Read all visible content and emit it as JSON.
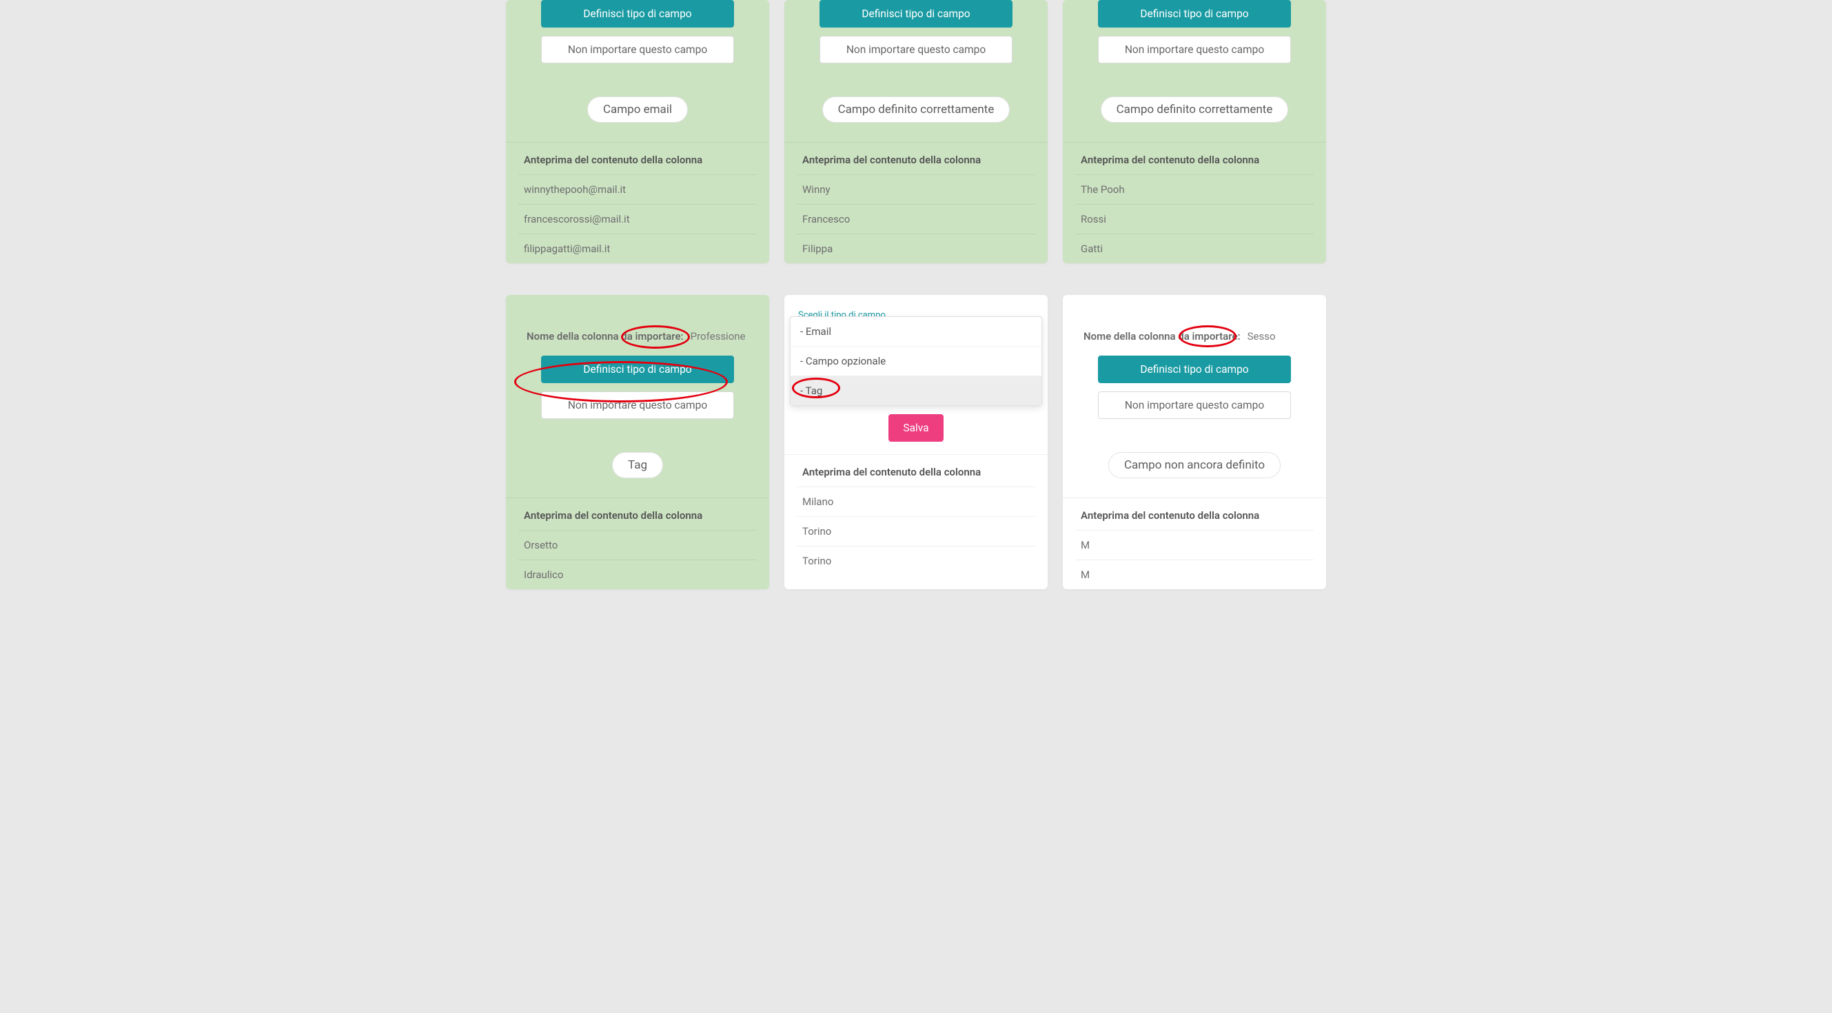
{
  "labels": {
    "define_field": "Definisci tipo di campo",
    "dont_import": "Non importare questo campo",
    "preview_header": "Anteprima del contenuto della colonna",
    "column_to_import": "Nome della colonna da importare:",
    "save": "Salva",
    "choose_field_type": "Scegli il tipo di campo"
  },
  "row1": [
    {
      "badge": "Campo email",
      "preview": [
        "winnythepooh@mail.it",
        "francescorossi@mail.it",
        "filippagatti@mail.it"
      ]
    },
    {
      "badge": "Campo definito correttamente",
      "preview": [
        "Winny",
        "Francesco",
        "Filippa"
      ]
    },
    {
      "badge": "Campo definito correttamente",
      "preview": [
        "The Pooh",
        "Rossi",
        "Gatti"
      ]
    }
  ],
  "row2_left": {
    "column_name": "Professione",
    "badge": "Tag",
    "preview": [
      "Orsetto",
      "Idraulico"
    ]
  },
  "row2_middle": {
    "options": [
      "- Email",
      "- Campo opzionale",
      "- Tag"
    ],
    "selected_index": 2,
    "preview": [
      "Milano",
      "Torino",
      "Torino"
    ]
  },
  "row2_right": {
    "column_name": "Sesso",
    "badge": "Campo non ancora definito",
    "preview": [
      "M",
      "M"
    ]
  }
}
